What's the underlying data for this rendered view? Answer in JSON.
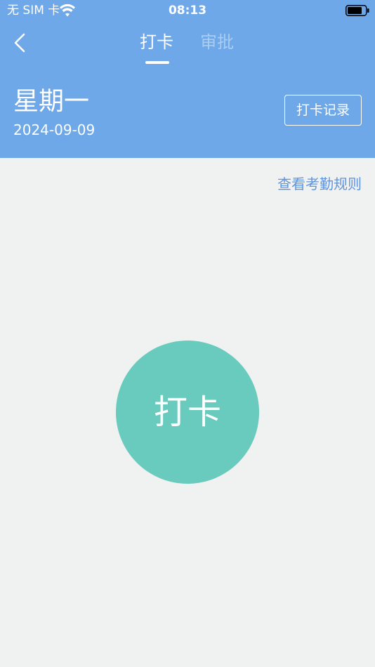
{
  "status_bar": {
    "carrier": "无 SIM 卡",
    "time": "08:13",
    "wifi_icon": "wifi-icon",
    "battery_icon": "battery-icon"
  },
  "nav": {
    "back_icon": "chevron-left-icon",
    "tabs": [
      {
        "label": "打卡",
        "active": true
      },
      {
        "label": "审批",
        "active": false
      }
    ]
  },
  "header": {
    "weekday": "星期一",
    "date": "2024-09-09",
    "records_button_label": "打卡记录"
  },
  "main": {
    "rules_link_label": "查看考勤规则",
    "punch_button_label": "打卡"
  },
  "colors": {
    "header_bg": "#6ea8e8",
    "page_bg": "#f0f1f1",
    "link": "#5f95dc",
    "punch_button": "#68cbbe",
    "inactive_tab": "#a9cdf2"
  }
}
